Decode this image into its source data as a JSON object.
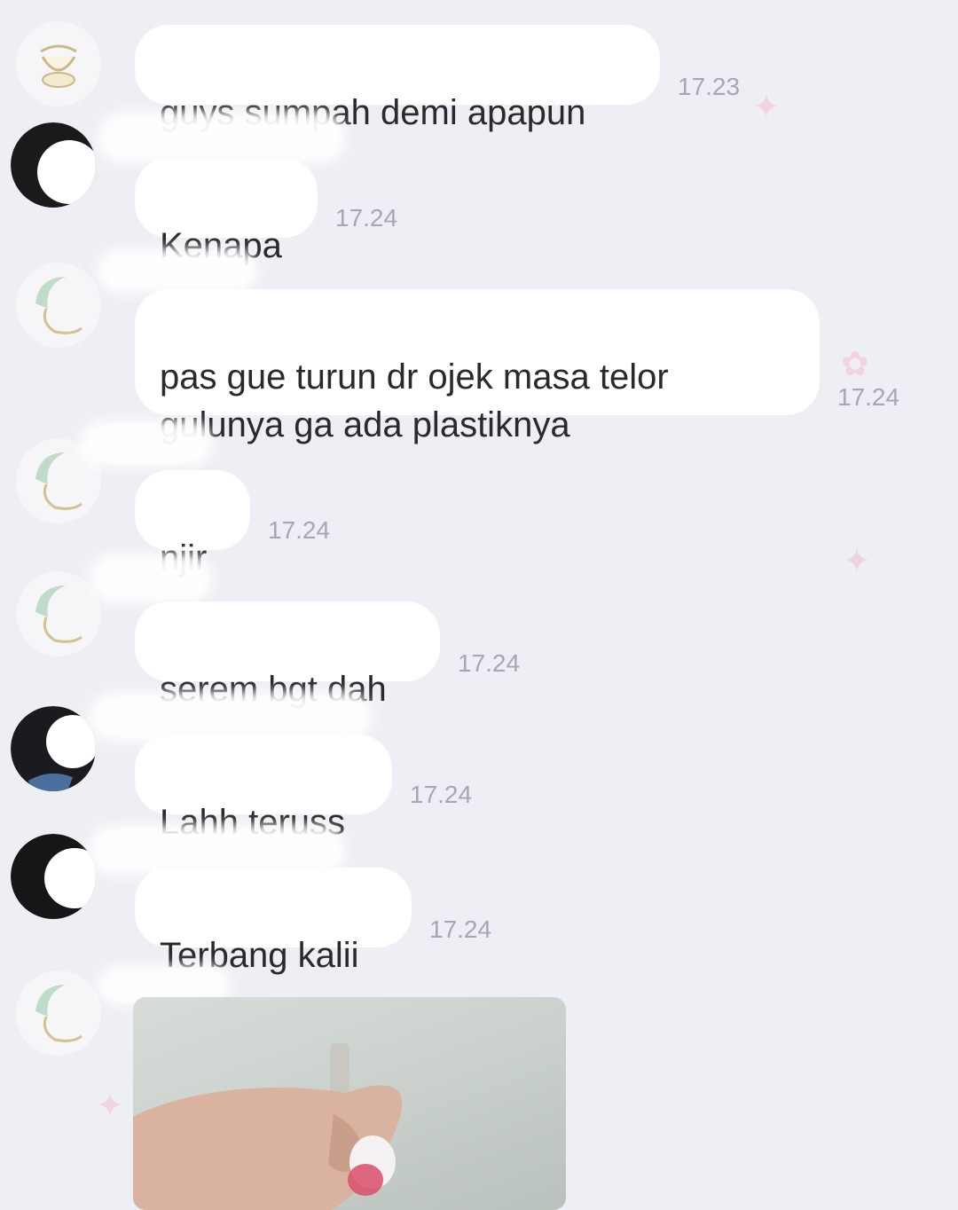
{
  "messages": [
    {
      "text": "guys sumpah demi apapun",
      "time": "17.23"
    },
    {
      "text": "Kenapa",
      "time": "17.24"
    },
    {
      "text": "pas gue turun dr ojek masa telor\ngulunya ga ada plastiknya",
      "time": "17.24"
    },
    {
      "text": "njir",
      "time": "17.24"
    },
    {
      "text": "serem bgt dah",
      "time": "17.24"
    },
    {
      "text": "Lahh teruss",
      "time": "17.24"
    },
    {
      "text": "Terbang kalii",
      "time": "17.24"
    }
  ],
  "colors": {
    "background": "#eeeef5",
    "bubble": "#ffffff",
    "timestamp": "#a6a6b6",
    "text": "#2a2a2a"
  },
  "icons": {
    "sticker_avatar": "cartoon-sticker-avatar",
    "photo_avatar": "profile-photo-avatar",
    "decoration": "sparkle-icon"
  }
}
